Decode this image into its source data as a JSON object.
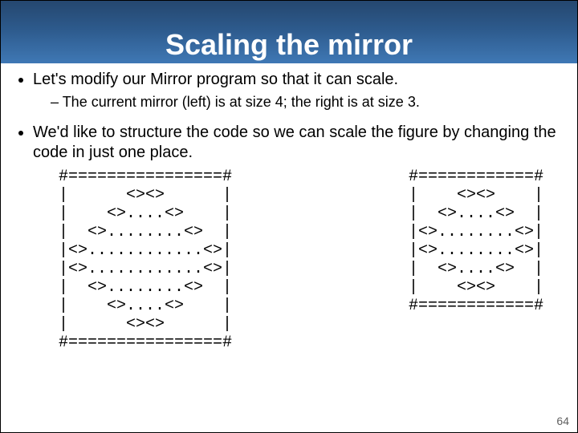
{
  "title": "Scaling the mirror",
  "bullets": {
    "b1": "Let's modify our Mirror program so that it can scale.",
    "b1_sub": "The current mirror (left) is at size 4; the right is at size 3.",
    "b2": "We'd like to structure the code so we can scale the figure by changing the code in just one place."
  },
  "mirror_left": "#================#\n|      <><>      |\n|    <>....<>    |\n|  <>........<>  |\n|<>............<>|\n|<>............<>|\n|  <>........<>  |\n|    <>....<>    |\n|      <><>      |\n#================#",
  "mirror_right": "#============#\n|    <><>    |\n|  <>....<>  |\n|<>........<>|\n|<>........<>|\n|  <>....<>  |\n|    <><>    |\n#============#",
  "page_number": "64"
}
